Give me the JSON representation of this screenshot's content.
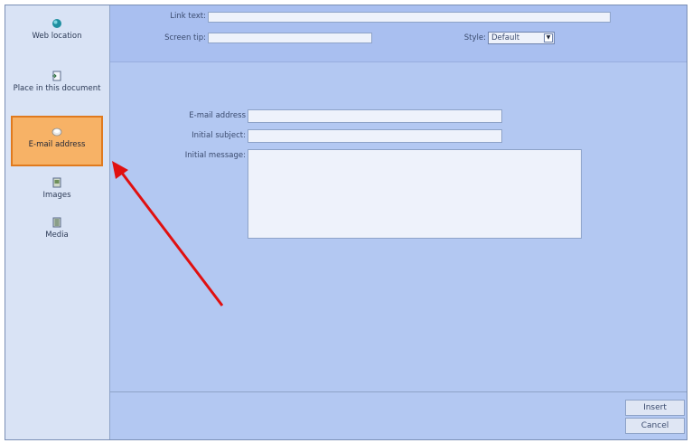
{
  "sidebar": {
    "items": [
      {
        "label": "Web location",
        "icon": "globe-icon"
      },
      {
        "label": "Place in this document",
        "icon": "document-icon"
      },
      {
        "label": "E-mail address",
        "icon": "email-icon",
        "active": true
      },
      {
        "label": "Images",
        "icon": "image-icon"
      },
      {
        "label": "Media",
        "icon": "media-icon"
      }
    ]
  },
  "top": {
    "link_text_label": "Link text:",
    "link_text_value": "",
    "screen_tip_label": "Screen tip:",
    "screen_tip_value": "",
    "style_label": "Style:",
    "style_value": "Default"
  },
  "email_form": {
    "email_label": "E-mail address",
    "email_value": "",
    "subject_label": "Initial subject:",
    "subject_value": "",
    "message_label": "Initial message:",
    "message_value": ""
  },
  "buttons": {
    "insert": "Insert",
    "cancel": "Cancel"
  },
  "colors": {
    "accent_active": "#f7b266",
    "arrow": "#e01010",
    "panel": "#b3c8f2"
  }
}
